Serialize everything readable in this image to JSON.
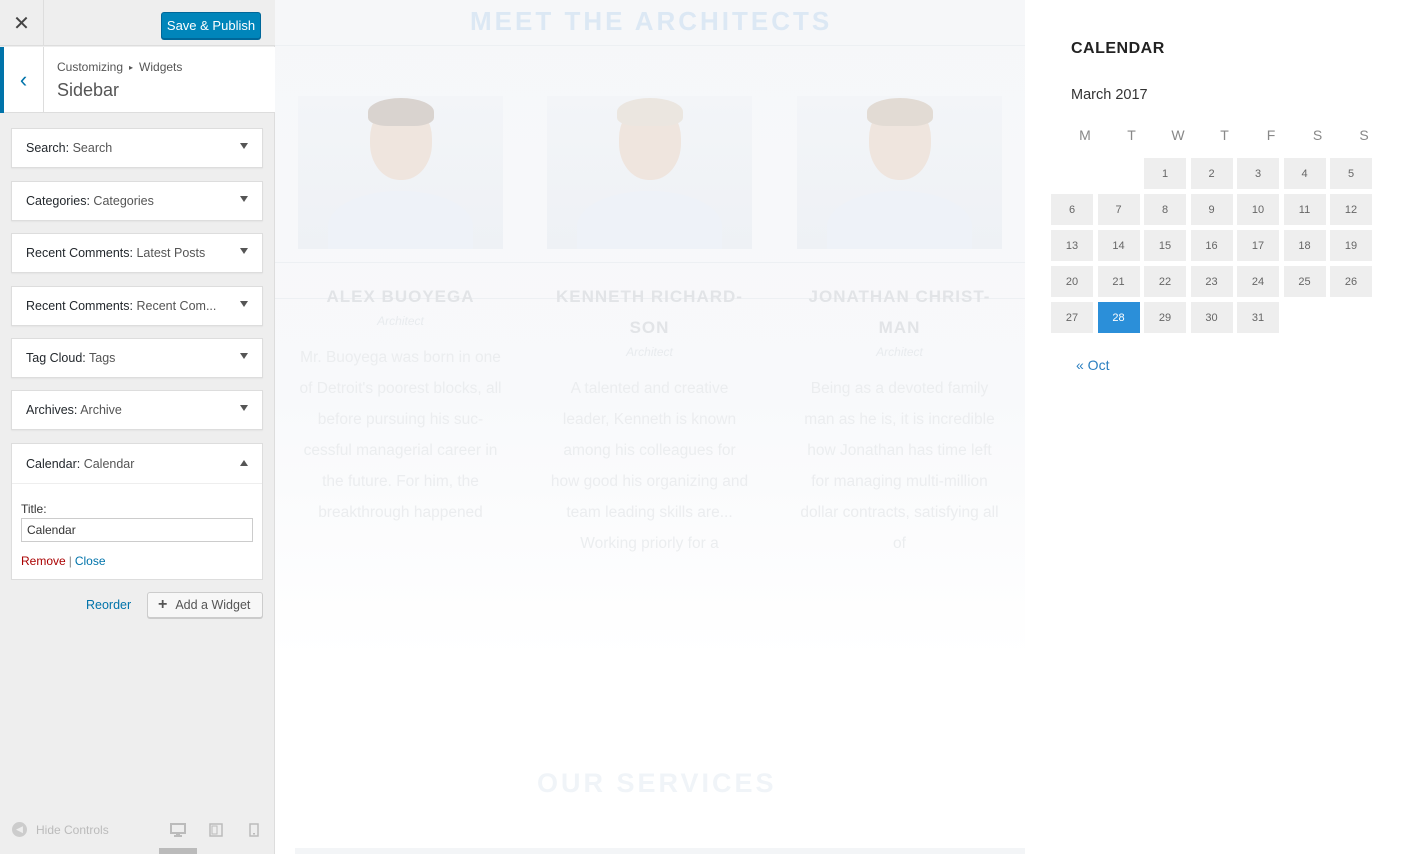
{
  "customizer": {
    "close_icon": "✕",
    "publish_label": "Save & Publish",
    "back_icon": "‹",
    "breadcrumb": {
      "root": "Customizing",
      "sep": "▸",
      "current": "Widgets"
    },
    "section_title": "Sidebar",
    "widgets": [
      {
        "type": "Search:",
        "title": "Search"
      },
      {
        "type": "Categories:",
        "title": "Categories"
      },
      {
        "type": "Recent Comments:",
        "title": "Latest Posts"
      },
      {
        "type": "Recent Comments:",
        "title": "Recent Com..."
      },
      {
        "type": "Tag Cloud:",
        "title": "Tags"
      },
      {
        "type": "Archives:",
        "title": "Archive"
      },
      {
        "type": "Calendar:",
        "title": "Calendar"
      }
    ],
    "calendar_form": {
      "title_label": "Title:",
      "title_value": "Calendar",
      "remove_label": "Remove",
      "pipe": "|",
      "close_label": "Close"
    },
    "reorder_label": "Reorder",
    "add_widget_label": "Add a Widget",
    "hide_controls_label": "Hide Controls"
  },
  "preview": {
    "architects_heading": "MEET THE ARCHITECTS",
    "people": [
      {
        "name": "ALEX BUOYEGA",
        "role": "Architect",
        "bio": "Mr. Buoyega was born in one of Detroit's poorest blocks, all before pursuing his suc-cessful managerial career in the future. For him, the breakthrough happened"
      },
      {
        "name": "KENNETH RICHARD-SON",
        "role": "Architect",
        "bio": "A talented and creative leader, Kenneth is known among his colleagues for how good his organizing and team leading skills are... Working priorly for a"
      },
      {
        "name": "JONATHAN CHRIST-MAN",
        "role": "Architect",
        "bio": "Being as a devoted family man as he is, it is incredible how Jonathan has time left for managing multi-million dollar contracts, satisfying all of"
      }
    ],
    "services_heading": "OUR SERVICES",
    "calendar": {
      "heading": "CALENDAR",
      "caption": "March 2017",
      "weekdays": [
        "M",
        "T",
        "W",
        "T",
        "F",
        "S",
        "S"
      ],
      "first_weekday_index": 2,
      "days_in_month": 31,
      "today": 28,
      "prev_link": "« Oct",
      "today_color": "#2b8fd9"
    }
  }
}
